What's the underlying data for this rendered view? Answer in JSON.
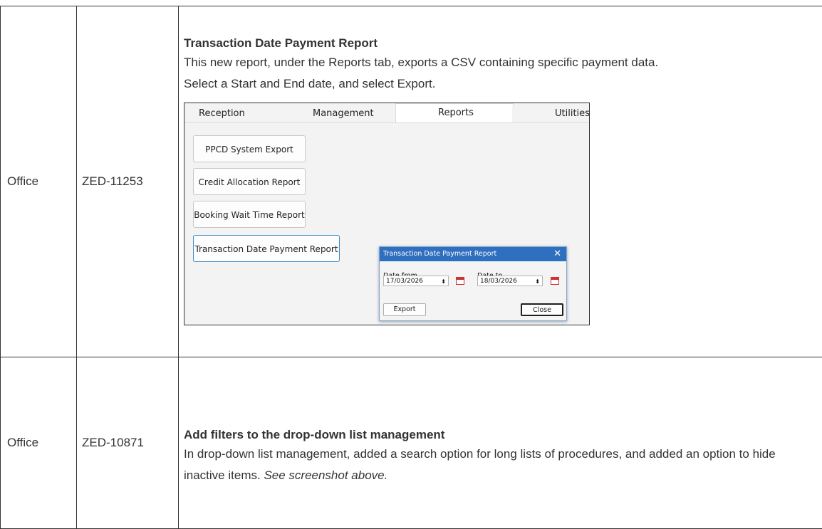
{
  "rows": [
    {
      "area": "Office",
      "ticket": "ZED-11253",
      "title": "Transaction Date Payment Report",
      "lines": [
        "This new report, under the Reports tab, exports a CSV containing specific payment data.",
        "Select a Start and End date, and select Export."
      ]
    },
    {
      "area": "Office",
      "ticket": "ZED-10871",
      "title": "Add filters to the drop-down list management",
      "text": "In drop-down list management, added a search option for long lists of procedures, and added an option to hide inactive items.",
      "note": "See screenshot above."
    }
  ],
  "screenshot": {
    "tabs": [
      "Reception",
      "Management",
      "Reports",
      "Utilities"
    ],
    "active_tab": "Reports",
    "report_buttons": [
      "PPCD System Export",
      "Credit Allocation Report",
      "Booking Wait Time Report",
      "Transaction Date Payment Report"
    ],
    "dialog": {
      "title": "Transaction Date Payment Report",
      "close_glyph": "✕",
      "date_from_label": "Date from",
      "date_from_value": "17/03/2026",
      "date_to_label": "Date to",
      "date_to_value": "18/03/2026",
      "spin_glyph": "⬍",
      "export_label": "Export",
      "close_label": "Close"
    }
  }
}
